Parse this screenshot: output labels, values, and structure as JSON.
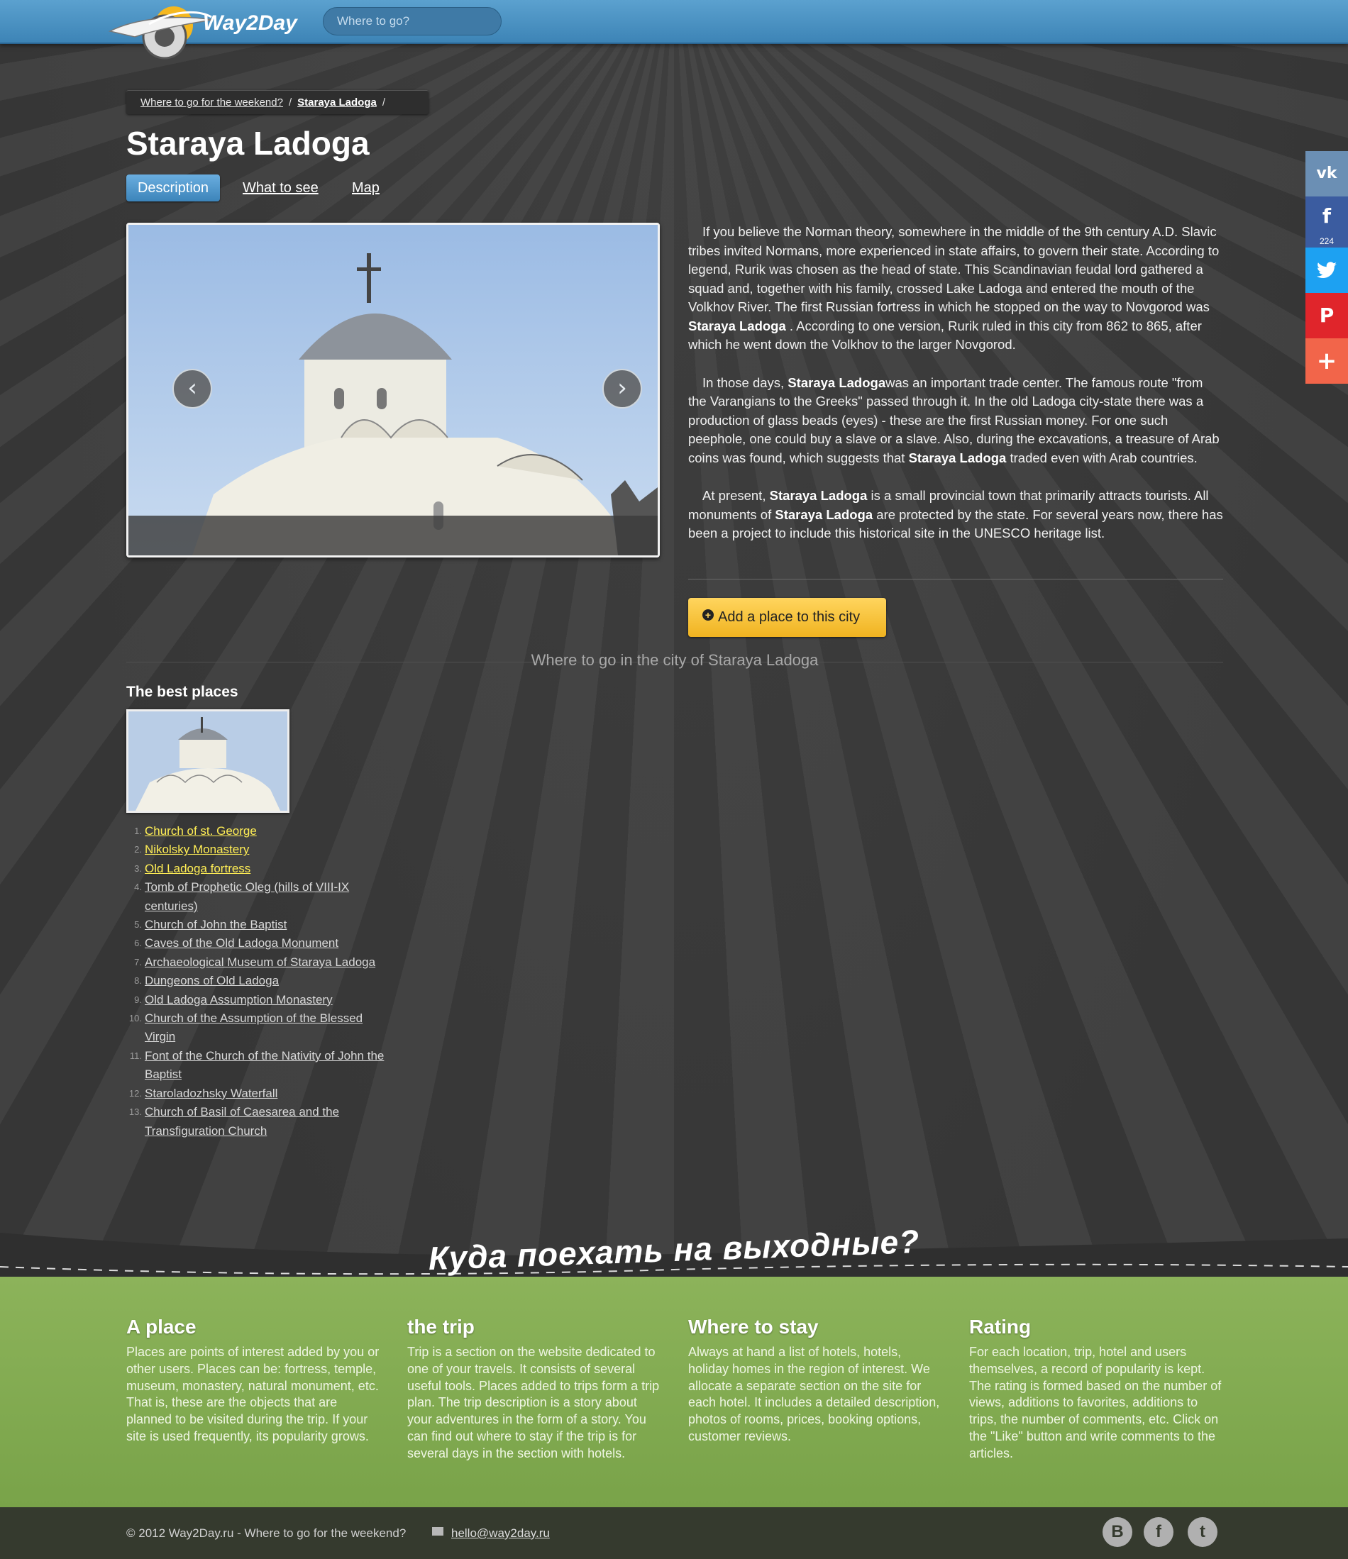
{
  "header": {
    "logo_text": "Way2Day",
    "search_placeholder": "Where to go?"
  },
  "breadcrumb": {
    "parent": "Where to go for the weekend?",
    "current": "Staraya Ladoga"
  },
  "page": {
    "title": "Staraya Ladoga",
    "tabs": [
      "Description",
      "What to see",
      "Map"
    ]
  },
  "article": {
    "p1": {
      "a": "If you believe the Norman theory, somewhere in the middle of the 9th century A.D. Slavic tribes invited Normans, more experienced in state affairs, to govern their state. According to legend, Rurik was chosen as the head of state. This Scandinavian feudal lord gathered a squad and, together with his family, crossed Lake Ladoga and entered the mouth of the Volkhov River. The first Russian fortress in which he stopped on the way to Novgorod was ",
      "b": "Staraya Ladoga",
      "c": " . According to one version, Rurik ruled in this city from 862 to 865, after which he went down the Volkhov to the larger Novgorod."
    },
    "p2": {
      "a": "In those days, ",
      "b": "Staraya Ladoga",
      "c": "was an important trade center. The famous route \"from the Varangians to the Greeks\" passed through it. In the old Ladoga city-state there was a production of glass beads (eyes) - these are the first Russian money. For one such peephole, one could buy a slave or a slave. Also, during the excavations, a treasure of Arab coins was found, which suggests that ",
      "d": "Staraya Ladoga",
      "e": " traded even with Arab countries."
    },
    "p3": {
      "a": "At present, ",
      "b": "Staraya Ladoga",
      "c": " is a small provincial town that primarily attracts tourists. All monuments of ",
      "d": "Staraya Ladoga",
      "e": " are protected by the state. For several years now, there has been a project to include this historical site in the UNESCO heritage list."
    }
  },
  "add_place_label": "Add a place to this city",
  "section_heading": "Where to go in the city of Staraya Ladoga",
  "best_places": {
    "title": "The best places",
    "items": [
      {
        "num": "1.",
        "label": "Church of st. George"
      },
      {
        "num": "2.",
        "label": "Nikolsky Monastery"
      },
      {
        "num": "3.",
        "label": "Old Ladoga fortress"
      },
      {
        "num": "4.",
        "label": "Tomb of Prophetic Oleg (hills of VIII-IX centuries)"
      },
      {
        "num": "5.",
        "label": "Church of John the Baptist"
      },
      {
        "num": "6.",
        "label": "Caves of the Old Ladoga Monument"
      },
      {
        "num": "7.",
        "label": "Archaeological Museum of Staraya Ladoga"
      },
      {
        "num": "8.",
        "label": "Dungeons of Old Ladoga"
      },
      {
        "num": "9.",
        "label": "Old Ladoga Assumption Monastery"
      },
      {
        "num": "10.",
        "label": "Church of the Assumption of the Blessed Virgin"
      },
      {
        "num": "11.",
        "label": "Font of the Church of the Nativity of John the Baptist"
      },
      {
        "num": "12.",
        "label": "Staroladozhsky Waterfall"
      },
      {
        "num": "13.",
        "label": "Church of Basil of Caesarea and the Transfiguration Church"
      }
    ]
  },
  "share": {
    "vk": "vk",
    "fb_count": "224"
  },
  "banner_text": "Куда поехать на выходные?",
  "footer_columns": [
    {
      "title": "A place",
      "text": "Places are points of interest added by you or other users. Places can be: fortress, temple, museum, monastery, natural monument, etc. That is, these are the objects that are planned to be visited during the trip. If your site is used frequently, its popularity grows."
    },
    {
      "title": "the trip",
      "text": "Trip is a section on the website dedicated to one of your travels. It consists of several useful tools. Places added to trips form a trip plan. The trip description is a story about your adventures in the form of a story. You can find out where to stay if the trip is for several days in the section with hotels."
    },
    {
      "title": "Where to stay",
      "text": "Always at hand a list of hotels, hotels, holiday homes in the region of interest. We allocate a separate section on the site for each hotel. It includes a detailed description, photos of rooms, prices, booking options, customer reviews."
    },
    {
      "title": "Rating",
      "text": "For each location, trip, hotel and users themselves, a record of popularity is kept. The rating is formed based on the number of views, additions to favorites, additions to trips, the number of comments, etc. Click on the \"Like\" button and write comments to the articles."
    }
  ],
  "bottom_bar": {
    "copyright": "© 2012 Way2Day.ru - Where to go for the weekend?",
    "email": "hello@way2day.ru"
  },
  "colors": {
    "header_blue": "#4a92c5",
    "accent_yellow": "#f7c340",
    "footer_green": "#82ac52",
    "link_highlight": "#ffee55"
  }
}
